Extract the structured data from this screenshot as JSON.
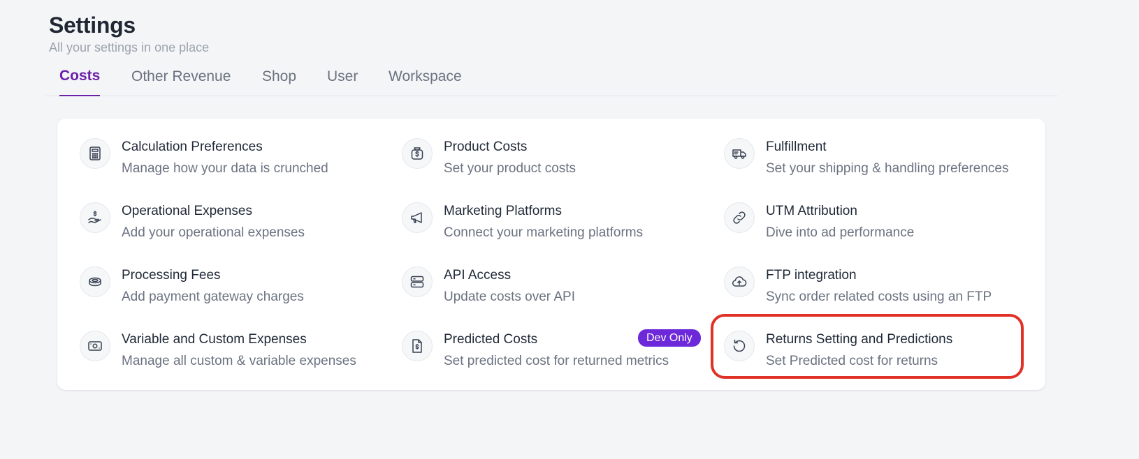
{
  "header": {
    "title": "Settings",
    "subtitle": "All your settings in one place"
  },
  "tabs": [
    {
      "label": "Costs",
      "active": true
    },
    {
      "label": "Other Revenue",
      "active": false
    },
    {
      "label": "Shop",
      "active": false
    },
    {
      "label": "User",
      "active": false
    },
    {
      "label": "Workspace",
      "active": false
    }
  ],
  "items": [
    {
      "title": "Calculation Preferences",
      "desc": "Manage how your data is crunched",
      "icon": "calculator-icon"
    },
    {
      "title": "Product Costs",
      "desc": "Set your product costs",
      "icon": "dollar-bag-icon"
    },
    {
      "title": "Fulfillment",
      "desc": "Set your shipping & handling preferences",
      "icon": "truck-icon"
    },
    {
      "title": "Operational Expenses",
      "desc": "Add your operational expenses",
      "icon": "hand-dollar-icon"
    },
    {
      "title": "Marketing Platforms",
      "desc": "Connect your marketing platforms",
      "icon": "megaphone-icon"
    },
    {
      "title": "UTM Attribution",
      "desc": "Dive into ad performance",
      "icon": "link-icon"
    },
    {
      "title": "Processing Fees",
      "desc": "Add payment gateway charges",
      "icon": "coins-icon"
    },
    {
      "title": "API Access",
      "desc": "Update costs over API",
      "icon": "server-icon"
    },
    {
      "title": "FTP integration",
      "desc": "Sync order related costs using an FTP",
      "icon": "cloud-upload-icon"
    },
    {
      "title": "Variable and Custom Expenses",
      "desc": "Manage all custom & variable expenses",
      "icon": "cash-icon"
    },
    {
      "title": "Predicted Costs",
      "desc": "Set predicted cost for returned metrics",
      "icon": "document-dollar-icon",
      "badge": "Dev Only"
    },
    {
      "title": "Returns Setting and Predictions",
      "desc": "Set Predicted cost for returns",
      "icon": "rotate-icon"
    }
  ],
  "colors": {
    "accent": "#6b21a8",
    "badge": "#6d28d9",
    "highlight": "#e03127"
  }
}
